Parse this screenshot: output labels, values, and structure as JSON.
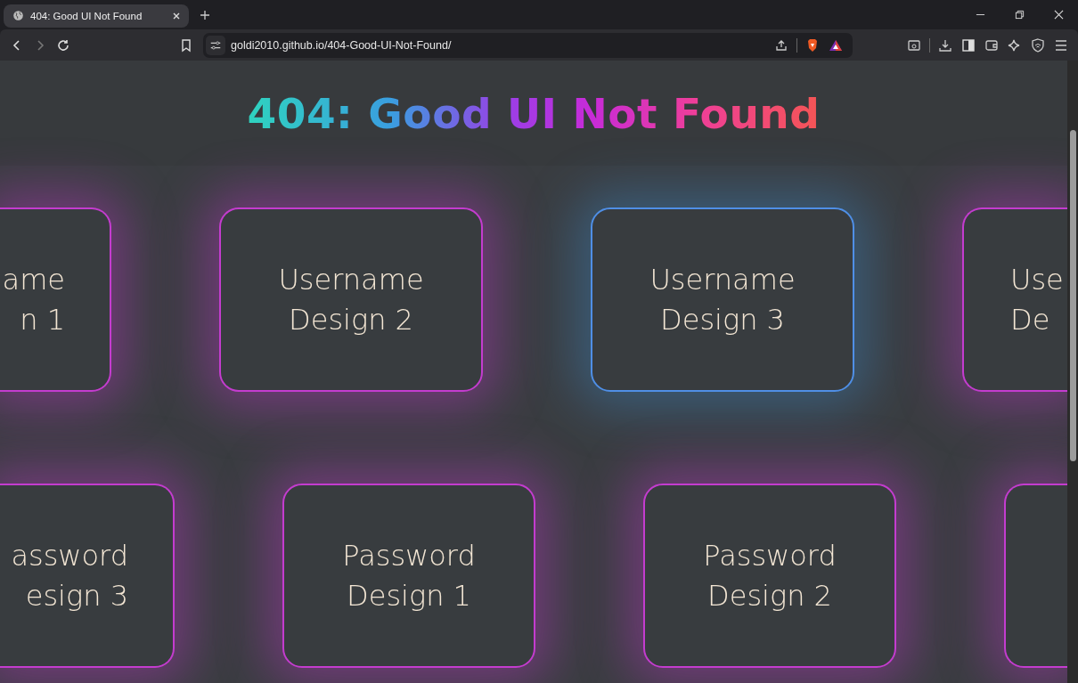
{
  "browser": {
    "tabs": [
      {
        "title": "404: Good UI Not Found",
        "selected": true
      }
    ],
    "url": "goldi2010.github.io/404-Good-UI-Not-Found/"
  },
  "page": {
    "title": "404: Good UI Not Found",
    "rows": [
      {
        "cards": [
          {
            "kind": "cut-left",
            "label": "ame\nn 1"
          },
          {
            "kind": "full",
            "label": "Username\nDesign 2"
          },
          {
            "kind": "full",
            "label": "Username\nDesign 3"
          },
          {
            "kind": "cut-right",
            "label": "Use\nDe"
          }
        ]
      },
      {
        "cards": [
          {
            "kind": "cut-left",
            "label": "assword\nesign 3"
          },
          {
            "kind": "full",
            "label": "Password\nDesign 1"
          },
          {
            "kind": "full",
            "label": "Password\nDesign 2"
          },
          {
            "kind": "cut-right"
          }
        ]
      }
    ]
  }
}
